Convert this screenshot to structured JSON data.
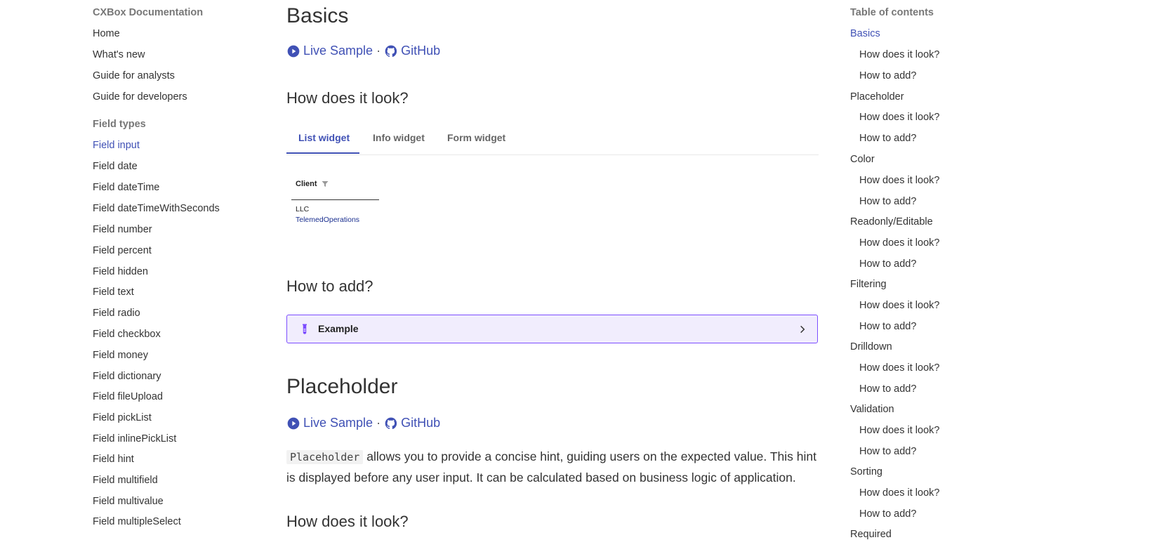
{
  "leftnav": {
    "title": "CXBox Documentation",
    "top_items": [
      "Home",
      "What's new",
      "Guide for analysts",
      "Guide for developers"
    ],
    "section_title": "Field types",
    "field_items": [
      "Field input",
      "Field date",
      "Field dateTime",
      "Field dateTimeWithSeconds",
      "Field number",
      "Field percent",
      "Field hidden",
      "Field text",
      "Field radio",
      "Field checkbox",
      "Field money",
      "Field dictionary",
      "Field fileUpload",
      "Field pickList",
      "Field inlinePickList",
      "Field hint",
      "Field multifield",
      "Field multivalue",
      "Field multipleSelect"
    ],
    "active_item": "Field input"
  },
  "main": {
    "basics_title": "Basics",
    "live_sample": "Live Sample",
    "separator": "·",
    "github": "GitHub",
    "how_look": "How does it look?",
    "tabs": [
      "List widget",
      "Info widget",
      "Form widget"
    ],
    "table": {
      "header": "Client",
      "cell_line1": "LLC",
      "cell_line2": "TelemedOperations"
    },
    "how_add": "How to add?",
    "example": "Example",
    "placeholder_title": "Placeholder",
    "placeholder_code": "Placeholder",
    "placeholder_text": " allows you to provide a concise hint, guiding users on the expected value. This hint is displayed before any user input. It can be calculated based on business logic of application.",
    "how_look_2": "How does it look?"
  },
  "toc": {
    "title": "Table of contents",
    "sections": [
      "Basics",
      "Placeholder",
      "Color",
      "Readonly/Editable",
      "Filtering",
      "Drilldown",
      "Validation",
      "Sorting",
      "Required"
    ],
    "sub_look": "How does it look?",
    "sub_add": "How to add?"
  },
  "colors": {
    "accent": "#4051b5",
    "admonition_border": "#7c4dff",
    "admonition_bg": "#f1edfd"
  }
}
